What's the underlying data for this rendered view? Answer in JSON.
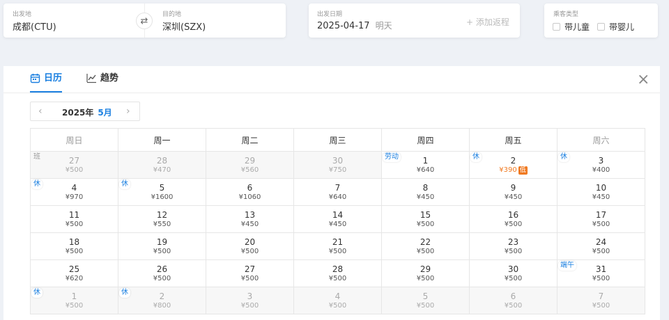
{
  "search": {
    "from_label": "出发地",
    "from_value": "成都(CTU)",
    "to_label": "目的地",
    "to_value": "深圳(SZX)",
    "swap_glyph": "⇄",
    "date_label": "出发日期",
    "date_value": "2025-04-17",
    "date_sub": "明天",
    "add_trip": "+ 添加返程",
    "pax_label": "乘客类型",
    "pax_child": "带儿童",
    "pax_infant": "带婴儿"
  },
  "tabs": {
    "calendar": "日历",
    "trend": "趋势",
    "calendar_icon": "calendar-icon",
    "trend_icon": "trend-chart-icon"
  },
  "close_glyph": "×",
  "month_nav": {
    "year": "2025年",
    "month": "5月",
    "prev": "‹",
    "next": "›"
  },
  "weekdays": [
    "周日",
    "周一",
    "周二",
    "周三",
    "周四",
    "周五",
    "周六"
  ],
  "weeks": [
    [
      {
        "day": "27",
        "price": "¥500",
        "other": true,
        "badge": "班",
        "badge_muted": true
      },
      {
        "day": "28",
        "price": "¥470",
        "other": true
      },
      {
        "day": "29",
        "price": "¥560",
        "other": true
      },
      {
        "day": "30",
        "price": "¥750",
        "other": true
      },
      {
        "day": "1",
        "price": "¥640",
        "badge": "劳动"
      },
      {
        "day": "2",
        "price": "¥390",
        "badge": "休",
        "low": true,
        "low_tag": "低"
      },
      {
        "day": "3",
        "price": "¥400",
        "badge": "休"
      }
    ],
    [
      {
        "day": "4",
        "price": "¥970",
        "badge": "休"
      },
      {
        "day": "5",
        "price": "¥1600",
        "badge": "休"
      },
      {
        "day": "6",
        "price": "¥1060"
      },
      {
        "day": "7",
        "price": "¥640"
      },
      {
        "day": "8",
        "price": "¥450"
      },
      {
        "day": "9",
        "price": "¥450"
      },
      {
        "day": "10",
        "price": "¥450"
      }
    ],
    [
      {
        "day": "11",
        "price": "¥500"
      },
      {
        "day": "12",
        "price": "¥550"
      },
      {
        "day": "13",
        "price": "¥450"
      },
      {
        "day": "14",
        "price": "¥450"
      },
      {
        "day": "15",
        "price": "¥500"
      },
      {
        "day": "16",
        "price": "¥500"
      },
      {
        "day": "17",
        "price": "¥500"
      }
    ],
    [
      {
        "day": "18",
        "price": "¥500"
      },
      {
        "day": "19",
        "price": "¥500"
      },
      {
        "day": "20",
        "price": "¥500"
      },
      {
        "day": "21",
        "price": "¥500"
      },
      {
        "day": "22",
        "price": "¥500"
      },
      {
        "day": "23",
        "price": "¥500"
      },
      {
        "day": "24",
        "price": "¥500"
      }
    ],
    [
      {
        "day": "25",
        "price": "¥620"
      },
      {
        "day": "26",
        "price": "¥500"
      },
      {
        "day": "27",
        "price": "¥500"
      },
      {
        "day": "28",
        "price": "¥500"
      },
      {
        "day": "29",
        "price": "¥500"
      },
      {
        "day": "30",
        "price": "¥500"
      },
      {
        "day": "31",
        "price": "¥500",
        "badge": "端午"
      }
    ],
    [
      {
        "day": "1",
        "price": "¥500",
        "other": true,
        "badge": "休"
      },
      {
        "day": "2",
        "price": "¥800",
        "other": true,
        "badge": "休"
      },
      {
        "day": "3",
        "price": "¥500",
        "other": true
      },
      {
        "day": "4",
        "price": "¥500",
        "other": true
      },
      {
        "day": "5",
        "price": "¥500",
        "other": true
      },
      {
        "day": "6",
        "price": "¥500",
        "other": true
      },
      {
        "day": "7",
        "price": "¥500",
        "other": true
      }
    ]
  ]
}
